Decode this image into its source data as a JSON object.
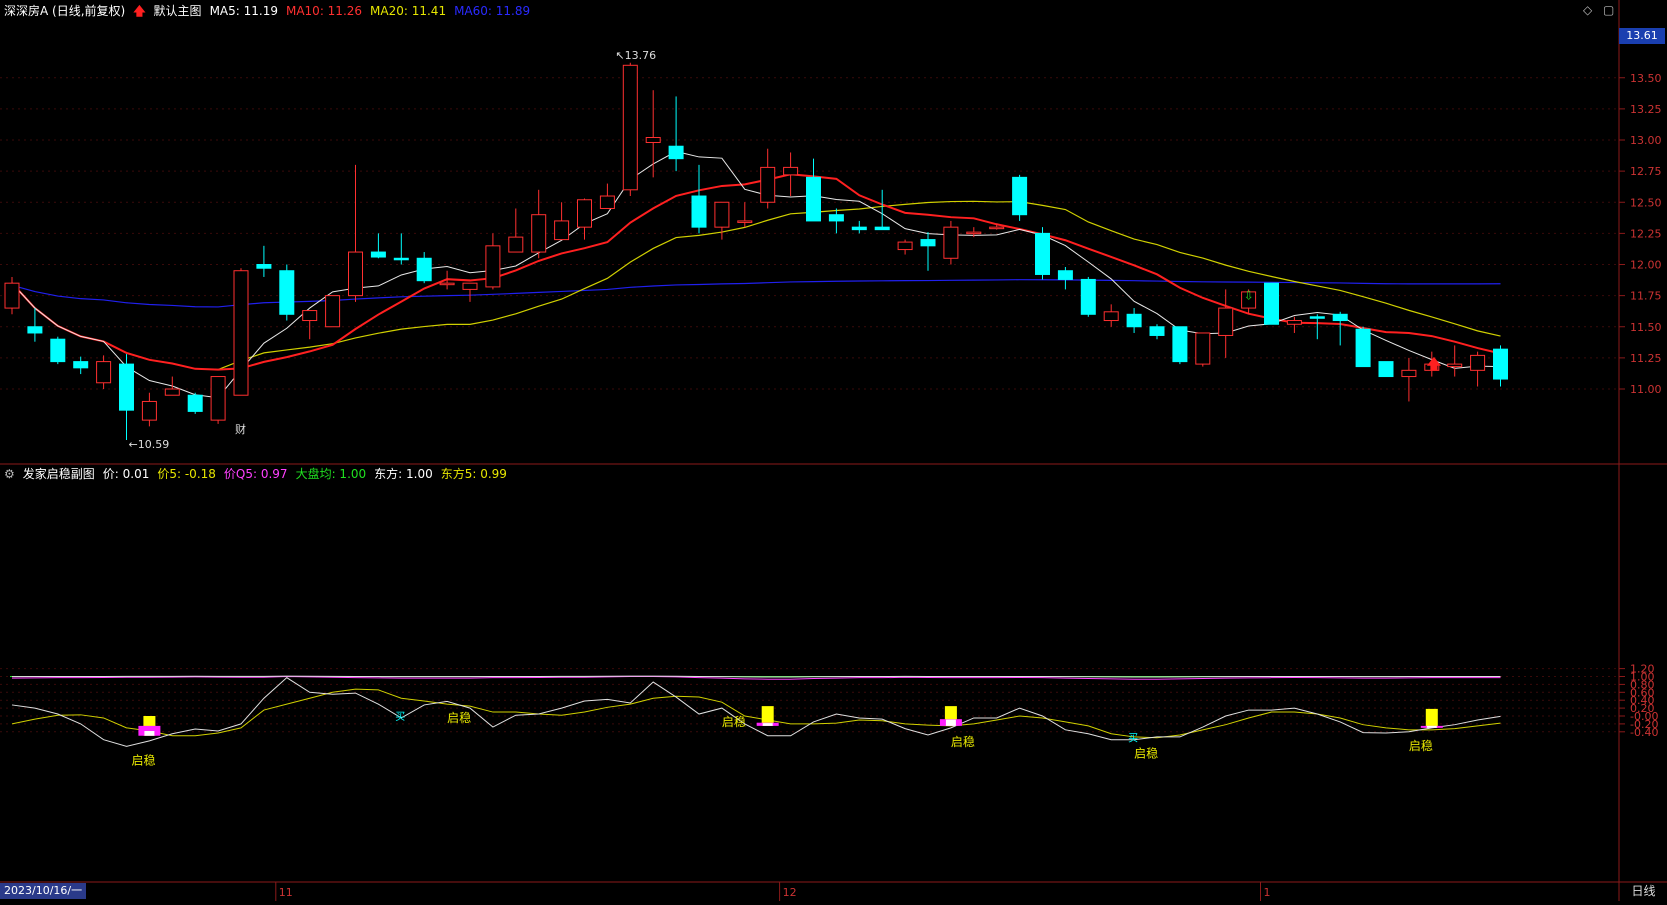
{
  "main_header": {
    "title": "深深房A (日线,前复权)",
    "arrow_icon": "red-up-arrow",
    "template": "默认主图",
    "ma5": "MA5: 11.19",
    "ma10": "MA10: 11.26",
    "ma20": "MA20: 11.41",
    "ma60": "MA60: 11.89",
    "colors": {
      "ma5": "#ffffff",
      "ma10": "#ff3030",
      "ma20": "#e6e600",
      "ma60": "#2020ff"
    }
  },
  "sub_header": {
    "title": "发家启稳副图",
    "price": "价: 0.01",
    "price5": "价5: -0.18",
    "priceq5": "价Q5: 0.97",
    "dapan": "大盘均: 1.00",
    "dongfang": "东方: 1.00",
    "dongfang5": "东方5: 0.99",
    "colors": {
      "price": "#ffffff",
      "price5": "#e6e600",
      "priceq5": "#ff40ff",
      "dapan": "#20e020",
      "dongfang": "#ffffff",
      "dongfang5": "#e6e600"
    }
  },
  "price_axis": {
    "ticks": [
      "13.50",
      "13.25",
      "13.00",
      "12.75",
      "12.50",
      "12.25",
      "12.00",
      "11.75",
      "11.50",
      "11.25",
      "11.00"
    ],
    "current": "13.61"
  },
  "sub_axis": {
    "ticks": [
      "1.20",
      "1.00",
      "0.80",
      "0.60",
      "0.40",
      "0.20",
      "-0.00",
      "-0.20",
      "-0.40"
    ]
  },
  "annotations": {
    "high": "13.76",
    "low": "10.59",
    "cai": "财",
    "qiwen": "启稳",
    "mai": "买"
  },
  "time_axis": {
    "first_date": "2023/10/16/一",
    "months": [
      "11",
      "12",
      "1"
    ],
    "period": "日线"
  },
  "chart_data": {
    "type": "candlestick",
    "ylim": [
      10.6,
      13.9
    ],
    "candles": [
      [
        11.65,
        11.9,
        11.6,
        11.85
      ],
      [
        11.5,
        11.65,
        11.38,
        11.45
      ],
      [
        11.4,
        11.42,
        11.2,
        11.22
      ],
      [
        11.22,
        11.26,
        11.12,
        11.17
      ],
      [
        11.05,
        11.27,
        11.0,
        11.22
      ],
      [
        11.2,
        11.28,
        10.59,
        10.83
      ],
      [
        10.75,
        10.97,
        10.7,
        10.9
      ],
      [
        10.95,
        11.1,
        10.95,
        11.0
      ],
      [
        10.95,
        10.97,
        10.8,
        10.82
      ],
      [
        10.75,
        11.1,
        10.72,
        11.1
      ],
      [
        10.95,
        11.97,
        10.95,
        11.95
      ],
      [
        12.0,
        12.15,
        11.9,
        11.97
      ],
      [
        11.95,
        12.0,
        11.55,
        11.6
      ],
      [
        11.55,
        11.63,
        11.4,
        11.63
      ],
      [
        11.5,
        11.75,
        11.5,
        11.75
      ],
      [
        11.75,
        12.8,
        11.7,
        12.1
      ],
      [
        12.1,
        12.25,
        12.05,
        12.06
      ],
      [
        12.05,
        12.25,
        12.0,
        12.04
      ],
      [
        12.05,
        12.1,
        11.85,
        11.87
      ],
      [
        11.85,
        11.95,
        11.8,
        11.85
      ],
      [
        11.8,
        11.85,
        11.7,
        11.85
      ],
      [
        11.82,
        12.25,
        11.8,
        12.15
      ],
      [
        12.1,
        12.45,
        12.1,
        12.22
      ],
      [
        12.1,
        12.6,
        12.05,
        12.4
      ],
      [
        12.2,
        12.5,
        12.2,
        12.35
      ],
      [
        12.3,
        12.53,
        12.2,
        12.52
      ],
      [
        12.45,
        12.65,
        12.45,
        12.55
      ],
      [
        12.6,
        13.62,
        12.55,
        13.6
      ],
      [
        12.98,
        13.4,
        12.7,
        13.02
      ],
      [
        12.95,
        13.35,
        12.75,
        12.85
      ],
      [
        12.55,
        12.8,
        12.25,
        12.3
      ],
      [
        12.3,
        12.5,
        12.2,
        12.5
      ],
      [
        12.35,
        12.5,
        12.3,
        12.35
      ],
      [
        12.5,
        12.93,
        12.45,
        12.78
      ],
      [
        12.72,
        12.9,
        12.55,
        12.78
      ],
      [
        12.7,
        12.85,
        12.35,
        12.35
      ],
      [
        12.4,
        12.45,
        12.25,
        12.35
      ],
      [
        12.3,
        12.35,
        12.25,
        12.28
      ],
      [
        12.3,
        12.6,
        12.3,
        12.28
      ],
      [
        12.12,
        12.2,
        12.08,
        12.18
      ],
      [
        12.2,
        12.26,
        11.95,
        12.15
      ],
      [
        12.05,
        12.35,
        12.0,
        12.3
      ],
      [
        12.25,
        12.3,
        12.22,
        12.26
      ],
      [
        12.3,
        12.33,
        12.28,
        12.3
      ],
      [
        12.7,
        12.72,
        12.35,
        12.4
      ],
      [
        12.25,
        12.3,
        11.88,
        11.92
      ],
      [
        11.95,
        11.98,
        11.8,
        11.88
      ],
      [
        11.88,
        11.9,
        11.58,
        11.6
      ],
      [
        11.55,
        11.68,
        11.5,
        11.62
      ],
      [
        11.6,
        11.65,
        11.45,
        11.5
      ],
      [
        11.5,
        11.52,
        11.4,
        11.43
      ],
      [
        11.5,
        11.5,
        11.2,
        11.22
      ],
      [
        11.2,
        11.45,
        11.18,
        11.45
      ],
      [
        11.43,
        11.8,
        11.25,
        11.65
      ],
      [
        11.65,
        11.8,
        11.6,
        11.78
      ],
      [
        11.85,
        11.85,
        11.52,
        11.52
      ],
      [
        11.52,
        11.58,
        11.45,
        11.55
      ],
      [
        11.58,
        11.6,
        11.4,
        11.57
      ],
      [
        11.6,
        11.62,
        11.35,
        11.55
      ],
      [
        11.48,
        11.5,
        11.18,
        11.18
      ],
      [
        11.22,
        11.22,
        11.1,
        11.1
      ],
      [
        11.1,
        11.25,
        10.9,
        11.15
      ],
      [
        11.15,
        11.3,
        11.1,
        11.2
      ],
      [
        11.18,
        11.35,
        11.1,
        11.2
      ],
      [
        11.15,
        11.3,
        11.02,
        11.27
      ],
      [
        11.32,
        11.35,
        11.02,
        11.08
      ]
    ],
    "sub_series": {
      "price": [
        0.28,
        0.2,
        0.05,
        -0.2,
        -0.6,
        -0.77,
        -0.63,
        -0.45,
        -0.33,
        -0.38,
        -0.2,
        0.45,
        0.97,
        0.6,
        0.55,
        0.58,
        0.3,
        -0.05,
        0.28,
        0.37,
        0.2,
        -0.28,
        0.02,
        0.05,
        0.2,
        0.38,
        0.42,
        0.33,
        0.86,
        0.48,
        0.05,
        0.2,
        -0.2,
        -0.5,
        -0.5,
        -0.15,
        0.05,
        -0.05,
        -0.08,
        -0.32,
        -0.48,
        -0.3,
        -0.05,
        -0.05,
        0.2,
        0.0,
        -0.35,
        -0.45,
        -0.6,
        -0.6,
        -0.53,
        -0.53,
        -0.28,
        0.0,
        0.15,
        0.15,
        0.2,
        0.05,
        -0.15,
        -0.42,
        -0.43,
        -0.4,
        -0.3,
        -0.22,
        -0.1,
        -0.01
      ],
      "price5": [
        -0.2,
        -0.08,
        0.02,
        0.03,
        -0.05,
        -0.3,
        -0.38,
        -0.5,
        -0.5,
        -0.43,
        -0.3,
        0.15,
        0.3,
        0.45,
        0.6,
        0.68,
        0.66,
        0.45,
        0.38,
        0.3,
        0.25,
        0.1,
        0.1,
        0.05,
        0.02,
        0.1,
        0.22,
        0.3,
        0.45,
        0.5,
        0.48,
        0.35,
        0.0,
        -0.1,
        -0.2,
        -0.2,
        -0.18,
        -0.1,
        -0.12,
        -0.2,
        -0.23,
        -0.25,
        -0.2,
        -0.1,
        0.0,
        -0.05,
        -0.15,
        -0.25,
        -0.45,
        -0.53,
        -0.55,
        -0.48,
        -0.35,
        -0.22,
        -0.05,
        0.1,
        0.1,
        0.05,
        -0.05,
        -0.22,
        -0.3,
        -0.35,
        -0.35,
        -0.32,
        -0.25,
        -0.18
      ],
      "priceq5": [
        0.96,
        0.965,
        0.97,
        0.97,
        0.975,
        0.98,
        0.98,
        0.985,
        0.99,
        0.985,
        0.98,
        0.98,
        1.0,
        0.99,
        0.98,
        0.97,
        0.965,
        0.96,
        0.96,
        0.96,
        0.96,
        0.97,
        0.97,
        0.975,
        0.98,
        0.98,
        0.99,
        1.0,
        1.0,
        0.99,
        0.97,
        0.96,
        0.94,
        0.93,
        0.93,
        0.95,
        0.96,
        0.97,
        0.97,
        0.98,
        0.975,
        0.97,
        0.97,
        0.97,
        0.975,
        0.97,
        0.96,
        0.95,
        0.94,
        0.93,
        0.93,
        0.94,
        0.95,
        0.96,
        0.965,
        0.97,
        0.975,
        0.97,
        0.965,
        0.96,
        0.96,
        0.965,
        0.97,
        0.97,
        0.97,
        0.97
      ],
      "dapan": 1.0,
      "qiwen_bars": [
        {
          "i": 6,
          "yellow": [
            -0.5,
            0.0
          ],
          "white": [
            -0.5,
            -0.38
          ],
          "magenta": [
            -0.5,
            -0.25
          ]
        },
        {
          "i": 33,
          "yellow": [
            -0.25,
            0.25
          ],
          "white": [
            -0.25,
            -0.18
          ],
          "magenta": [
            -0.25,
            -0.17
          ]
        },
        {
          "i": 41,
          "yellow": [
            -0.25,
            0.25
          ],
          "white": [
            -0.25,
            -0.09
          ],
          "magenta": [
            -0.25,
            -0.08
          ]
        },
        {
          "i": 62,
          "yellow": [
            -0.3,
            0.18
          ],
          "white": [
            -0.3,
            -0.25
          ],
          "magenta": [
            -0.3,
            -0.25
          ]
        }
      ],
      "qiwen_labels": [
        5,
        19,
        31,
        41,
        49,
        61
      ],
      "mai_labels": [
        17,
        49
      ]
    }
  }
}
